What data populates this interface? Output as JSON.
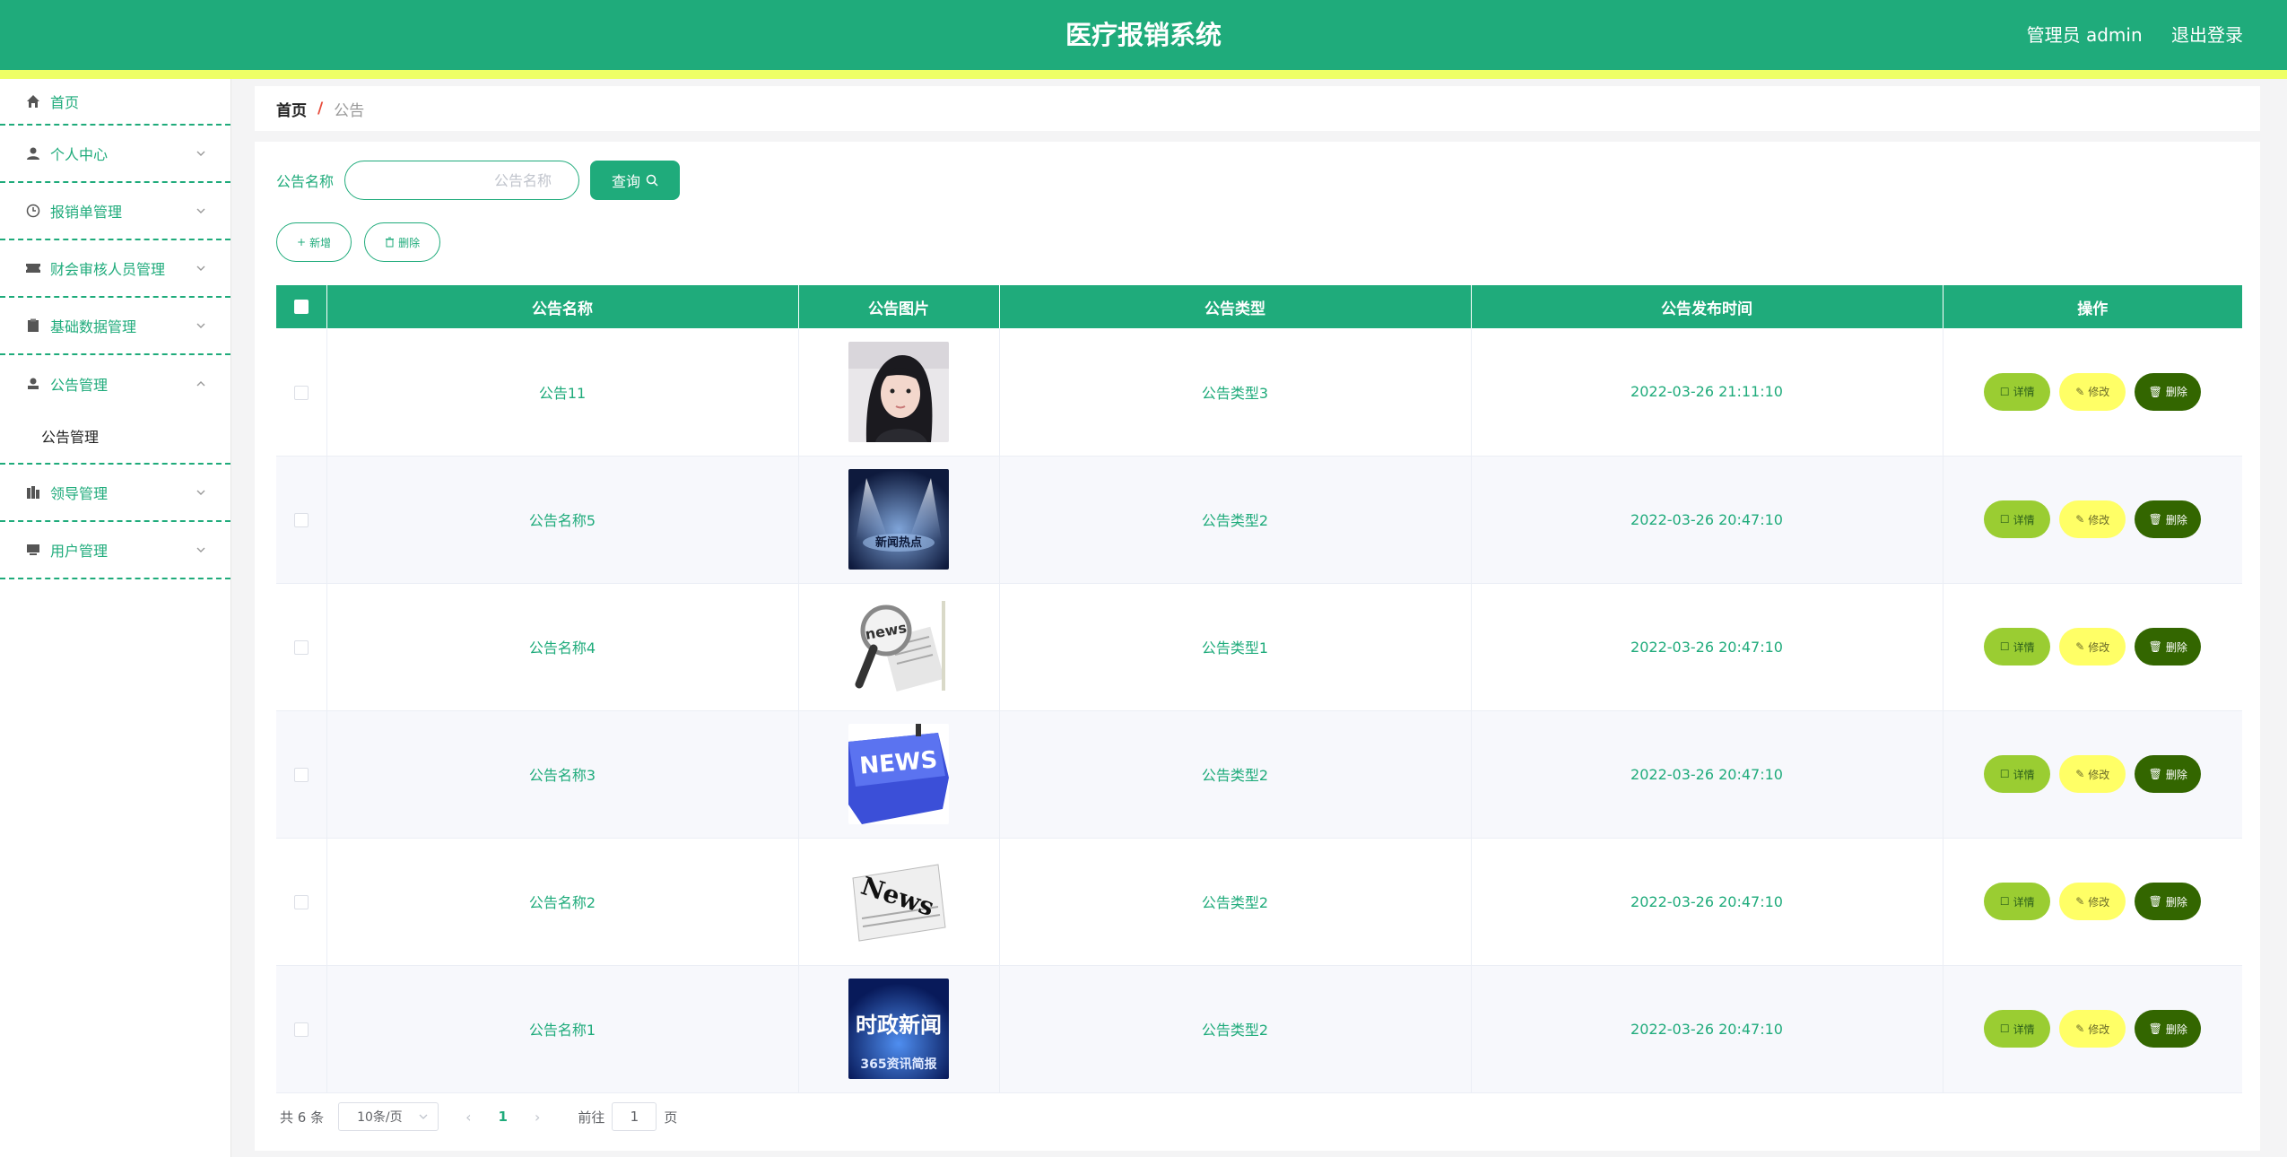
{
  "app": {
    "title": "医疗报销系统",
    "user_label": "管理员 admin",
    "logout_label": "退出登录"
  },
  "colors": {
    "primary": "#1fab7b",
    "strip": "#eeff66",
    "detail_button": "#9acd32",
    "edit_button": "#ffff66",
    "delete_button": "#336600"
  },
  "sidebar": {
    "items": [
      {
        "label": "首页",
        "icon": "home-icon"
      },
      {
        "label": "个人中心",
        "icon": "user-icon"
      },
      {
        "label": "报销单管理",
        "icon": "clock-icon"
      },
      {
        "label": "财会审核人员管理",
        "icon": "ticket-icon"
      },
      {
        "label": "基础数据管理",
        "icon": "clipboard-icon"
      },
      {
        "label": "公告管理",
        "icon": "stamp-icon"
      },
      {
        "label": "领导管理",
        "icon": "building-icon"
      },
      {
        "label": "用户管理",
        "icon": "monitor-icon"
      }
    ],
    "submenu": {
      "label": "公告管理"
    }
  },
  "breadcrumb": {
    "home": "首页",
    "separator": "/",
    "current": "公告"
  },
  "search": {
    "label": "公告名称",
    "placeholder": "公告名称",
    "button_label": "查询"
  },
  "actions": {
    "add_label": "新增",
    "delete_label": "删除"
  },
  "table": {
    "columns": [
      "公告名称",
      "公告图片",
      "公告类型",
      "公告发布时间",
      "操作"
    ],
    "row_buttons": {
      "detail": "详情",
      "edit": "修改",
      "delete": "删除"
    },
    "rows": [
      {
        "name": "公告11",
        "image": "portrait-photo",
        "type": "公告类型3",
        "time": "2022-03-26 21:11:10"
      },
      {
        "name": "公告名称5",
        "image": "spotlight-stage-photo",
        "type": "公告类型2",
        "time": "2022-03-26 20:47:10"
      },
      {
        "name": "公告名称4",
        "image": "magnifier-news-photo",
        "type": "公告类型1",
        "time": "2022-03-26 20:47:10"
      },
      {
        "name": "公告名称3",
        "image": "news-key-photo",
        "type": "公告类型2",
        "time": "2022-03-26 20:47:10"
      },
      {
        "name": "公告名称2",
        "image": "newspaper-photo",
        "type": "公告类型2",
        "time": "2022-03-26 20:47:10"
      },
      {
        "name": "公告名称1",
        "image": "politics-news-banner",
        "type": "公告类型2",
        "time": "2022-03-26 20:47:10"
      }
    ]
  },
  "thumb_texts": {
    "row2": "新闻热点",
    "row3": "news",
    "row4": "NEWS",
    "row5": "News",
    "row6_top": "时政新闻",
    "row6_bottom": "365资讯简报"
  },
  "pagination": {
    "total": "共 6 条",
    "page_size": "10条/页",
    "current_page": "1",
    "goto_prefix": "前往",
    "goto_value": "1",
    "goto_suffix": "页"
  }
}
